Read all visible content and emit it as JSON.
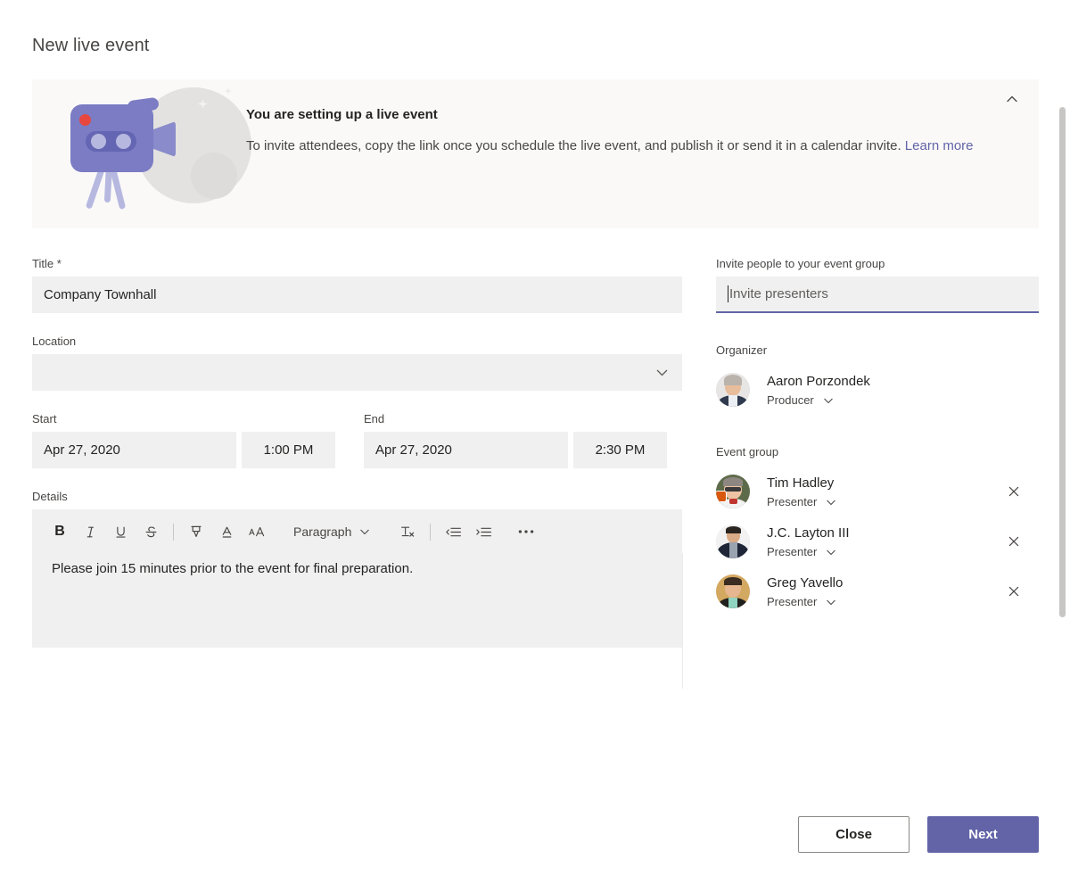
{
  "page_title": "New live event",
  "banner": {
    "heading": "You are setting up a live event",
    "body_part1": "To invite attendees, copy the link once you schedule the live event, and publish it or send it in a calendar invite. ",
    "link": "Learn more",
    "collapse_icon": "chevron-up-icon",
    "background": "#faf9f8",
    "illustration": "video-camera-tripod-illustration"
  },
  "form": {
    "title": {
      "label": "Title *",
      "value": "Company Townhall"
    },
    "location": {
      "label": "Location",
      "value": "",
      "chevron": "chevron-down-icon"
    },
    "start": {
      "label": "Start",
      "date": "Apr 27, 2020",
      "time": "1:00 PM"
    },
    "end": {
      "label": "End",
      "date": "Apr 27, 2020",
      "time": "2:30 PM"
    },
    "details": {
      "label": "Details",
      "body": "Please join 15 minutes prior to the event for final preparation.",
      "toolbar": {
        "bold": "B",
        "italic": "I",
        "underline": "U",
        "strikethrough": "S",
        "highlight": "highlighter-icon",
        "font_color": "font-color-icon",
        "font_size": "font-size-icon",
        "paragraph_style": "Paragraph",
        "paragraph_chevron": "chevron-down-icon",
        "clear_formatting": "clear-formatting-icon",
        "decrease_indent": "decrease-indent-icon",
        "increase_indent": "increase-indent-icon",
        "more_options": "more-options-icon"
      }
    }
  },
  "right": {
    "invite": {
      "label": "Invite people to your event group",
      "placeholder": "Invite presenters",
      "value": "",
      "focus_color": "#6264a7"
    },
    "organizer_label": "Organizer",
    "organizer": {
      "name": "Aaron Porzondek",
      "role": "Producer",
      "role_chevron": "chevron-down-icon",
      "avatar": "avatar-aaron-porzondek"
    },
    "event_group_label": "Event group",
    "event_group": [
      {
        "name": "Tim Hadley",
        "role": "Presenter",
        "role_chevron": "chevron-down-icon",
        "avatar": "avatar-tim-hadley",
        "remove_icon": "close-icon",
        "has_badge": true
      },
      {
        "name": "J.C. Layton III",
        "role": "Presenter",
        "role_chevron": "chevron-down-icon",
        "avatar": "avatar-jc-layton-iii",
        "remove_icon": "close-icon",
        "has_badge": false
      },
      {
        "name": "Greg Yavello",
        "role": "Presenter",
        "role_chevron": "chevron-down-icon",
        "avatar": "avatar-greg-yavello",
        "remove_icon": "close-icon",
        "has_badge": false
      }
    ]
  },
  "footer": {
    "close_label": "Close",
    "next_label": "Next",
    "next_color": "#6264a7"
  },
  "scrollbar": {
    "thumb_color": "#c8c6c4"
  }
}
